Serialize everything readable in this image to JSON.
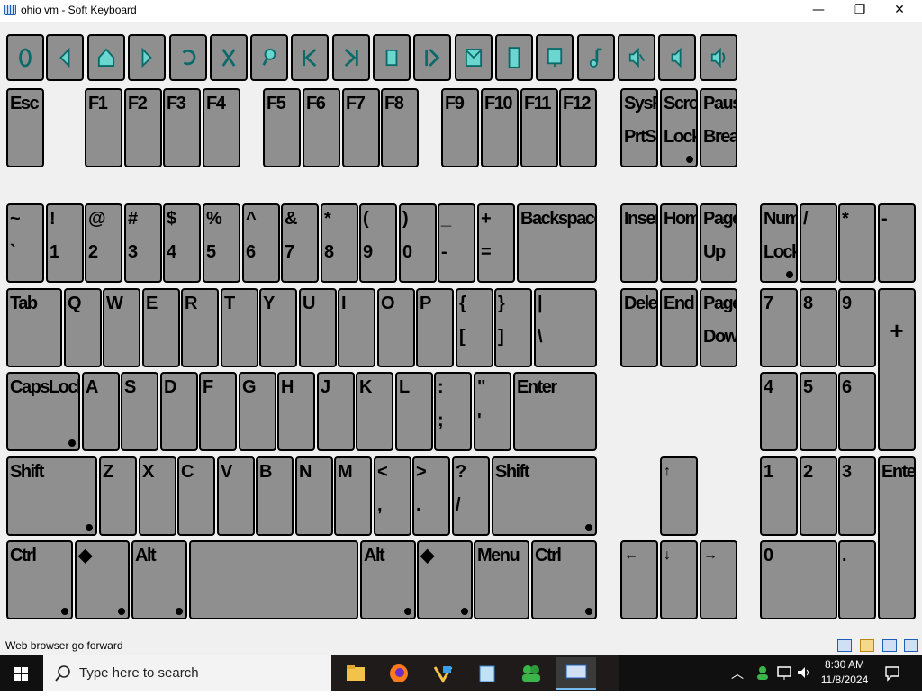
{
  "window": {
    "title": "ohio vm - Soft Keyboard",
    "minimize": "—",
    "maximize": "❐",
    "close": "✕"
  },
  "media_keys": [
    {
      "name": "power-icon"
    },
    {
      "name": "browser-back-icon"
    },
    {
      "name": "browser-home-icon"
    },
    {
      "name": "browser-forward-icon"
    },
    {
      "name": "browser-refresh-icon"
    },
    {
      "name": "browser-stop-icon"
    },
    {
      "name": "browser-search-icon"
    },
    {
      "name": "previous-track-icon"
    },
    {
      "name": "next-track-icon"
    },
    {
      "name": "stop-media-icon"
    },
    {
      "name": "play-pause-icon"
    },
    {
      "name": "mail-icon"
    },
    {
      "name": "calculator-icon"
    },
    {
      "name": "my-computer-icon"
    },
    {
      "name": "media-select-icon"
    },
    {
      "name": "volume-mute-icon"
    },
    {
      "name": "volume-down-icon"
    },
    {
      "name": "volume-up-icon"
    }
  ],
  "keys": {
    "esc": "Esc",
    "f1": "F1",
    "f2": "F2",
    "f3": "F3",
    "f4": "F4",
    "f5": "F5",
    "f6": "F6",
    "f7": "F7",
    "f8": "F8",
    "f9": "F9",
    "f10": "F10",
    "f11": "F11",
    "f12": "F12",
    "sysrq_top": "SysRq",
    "sysrq_bottom": "PrtScr",
    "scroll_top": "Scroll",
    "scroll_bottom": "Lock",
    "pause_top": "Pause",
    "pause_bottom": "Break",
    "tilde_top": "~",
    "tilde_bottom": "`",
    "k1_top": "!",
    "k1_bottom": "1",
    "k2_top": "@",
    "k2_bottom": "2",
    "k3_top": "#",
    "k3_bottom": "3",
    "k4_top": "$",
    "k4_bottom": "4",
    "k5_top": "%",
    "k5_bottom": "5",
    "k6_top": "^",
    "k6_bottom": "6",
    "k7_top": "&",
    "k7_bottom": "7",
    "k8_top": "*",
    "k8_bottom": "8",
    "k9_top": "(",
    "k9_bottom": "9",
    "k0_top": ")",
    "k0_bottom": "0",
    "minus_top": "_",
    "minus_bottom": "-",
    "equal_top": "+",
    "equal_bottom": "=",
    "backspace": "Backspace",
    "insert": "Insert",
    "home": "Home",
    "pageup_top": "Page",
    "pageup_bottom": "Up",
    "numlock_top": "Num",
    "numlock_bottom": "Lock",
    "np_div": "/",
    "np_mul": "*",
    "np_sub": "-",
    "tab": "Tab",
    "q": "Q",
    "w": "W",
    "e": "E",
    "r": "R",
    "t": "T",
    "y": "Y",
    "u": "U",
    "i": "I",
    "o": "O",
    "p": "P",
    "lbrace_top": "{",
    "lbrace_bottom": "[",
    "rbrace_top": "}",
    "rbrace_bottom": "]",
    "pipe_top": "|",
    "pipe_bottom": "\\",
    "delete": "Delete",
    "end": "End",
    "pagedown_top": "Page",
    "pagedown_bottom": "Down",
    "np7": "7",
    "np8": "8",
    "np9": "9",
    "np_add": "+",
    "capslock": "CapsLock",
    "a": "A",
    "s": "S",
    "d": "D",
    "f": "F",
    "g": "G",
    "h": "H",
    "j": "J",
    "k": "K",
    "l": "L",
    "colon_top": ":",
    "colon_bottom": ";",
    "quote_top": "\"",
    "quote_bottom": "'",
    "enter": "Enter",
    "np4": "4",
    "np5": "5",
    "np6": "6",
    "lshift": "Shift",
    "z": "Z",
    "x": "X",
    "c": "C",
    "v": "V",
    "b": "B",
    "n": "N",
    "m": "M",
    "comma_top": "<",
    "comma_bottom": ",",
    "period_top": ">",
    "period_bottom": ".",
    "slash_top": "?",
    "slash_bottom": "/",
    "rshift": "Shift",
    "up": "↑",
    "np1": "1",
    "np2": "2",
    "np3": "3",
    "np_enter": "Enter",
    "lctrl": "Ctrl",
    "lwin": "◆",
    "lalt": "Alt",
    "ralt": "Alt",
    "rwin": "◆",
    "menu": "Menu",
    "rctrl": "Ctrl",
    "left": "←",
    "down": "↓",
    "right": "→",
    "np0": "0",
    "np_dot": "."
  },
  "status": {
    "text": "Web browser go forward"
  },
  "taskbar": {
    "search_placeholder": "Type here to search",
    "time": "8:30 AM",
    "date": "11/8/2024"
  }
}
